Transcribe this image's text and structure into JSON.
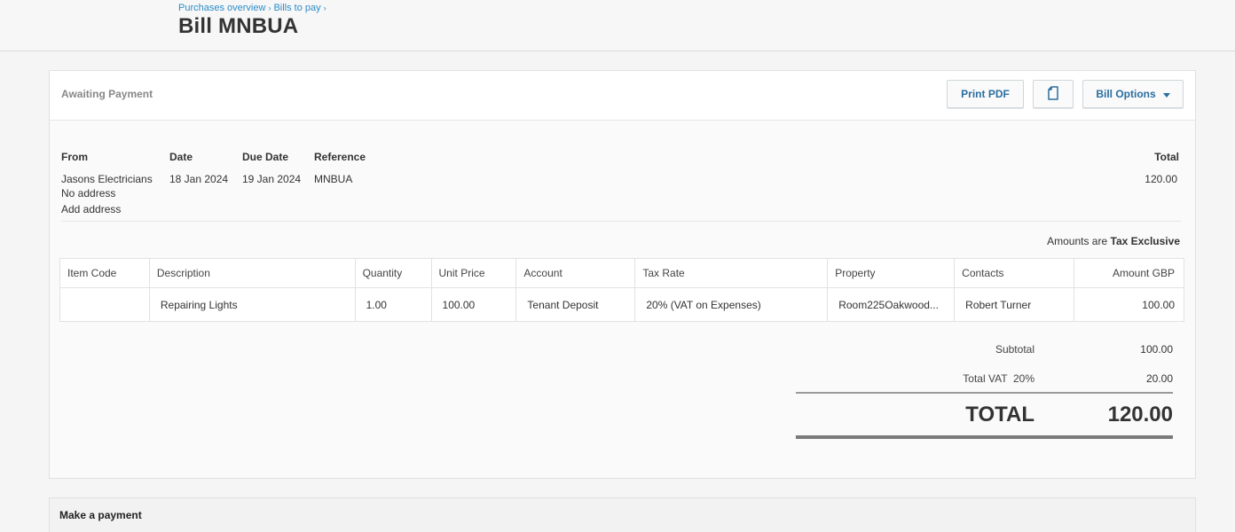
{
  "breadcrumb": {
    "items": [
      "Purchases overview",
      "Bills to pay"
    ],
    "separator": "›"
  },
  "page_title": "Bill MNBUA",
  "status": "Awaiting Payment",
  "toolbar": {
    "print_pdf_label": "Print PDF",
    "copy_icon": "document-copy-icon",
    "bill_options_label": "Bill Options"
  },
  "header": {
    "from_label": "From",
    "date_label": "Date",
    "due_date_label": "Due Date",
    "reference_label": "Reference",
    "total_label": "Total",
    "from_name": "Jasons Electricians",
    "address": "No address",
    "add_address_label": "Add address",
    "date": "18 Jan 2024",
    "due_date": "19 Jan 2024",
    "reference": "MNBUA",
    "total": "120.00"
  },
  "tax_note": {
    "prefix": "Amounts are",
    "mode": "Tax Exclusive"
  },
  "table": {
    "columns": [
      "Item Code",
      "Description",
      "Quantity",
      "Unit Price",
      "Account",
      "Tax Rate",
      "Property",
      "Contacts",
      "Amount GBP"
    ],
    "rows": [
      {
        "item_code": "",
        "description": "Repairing Lights",
        "quantity": "1.00",
        "unit_price": "100.00",
        "account": "Tenant Deposit",
        "tax_rate": "20% (VAT on Expenses)",
        "property": "Room225Oakwood...",
        "contacts": "Robert Turner",
        "amount": "100.00"
      }
    ]
  },
  "summary": {
    "subtotal_label": "Subtotal",
    "subtotal": "100.00",
    "vat_label": "Total VAT  20%",
    "vat": "20.00",
    "total_label": "TOTAL",
    "total": "120.00"
  },
  "payment": {
    "title": "Make a payment"
  },
  "colors": {
    "link": "#2a8cc7",
    "button_text": "#2a6ea0"
  }
}
